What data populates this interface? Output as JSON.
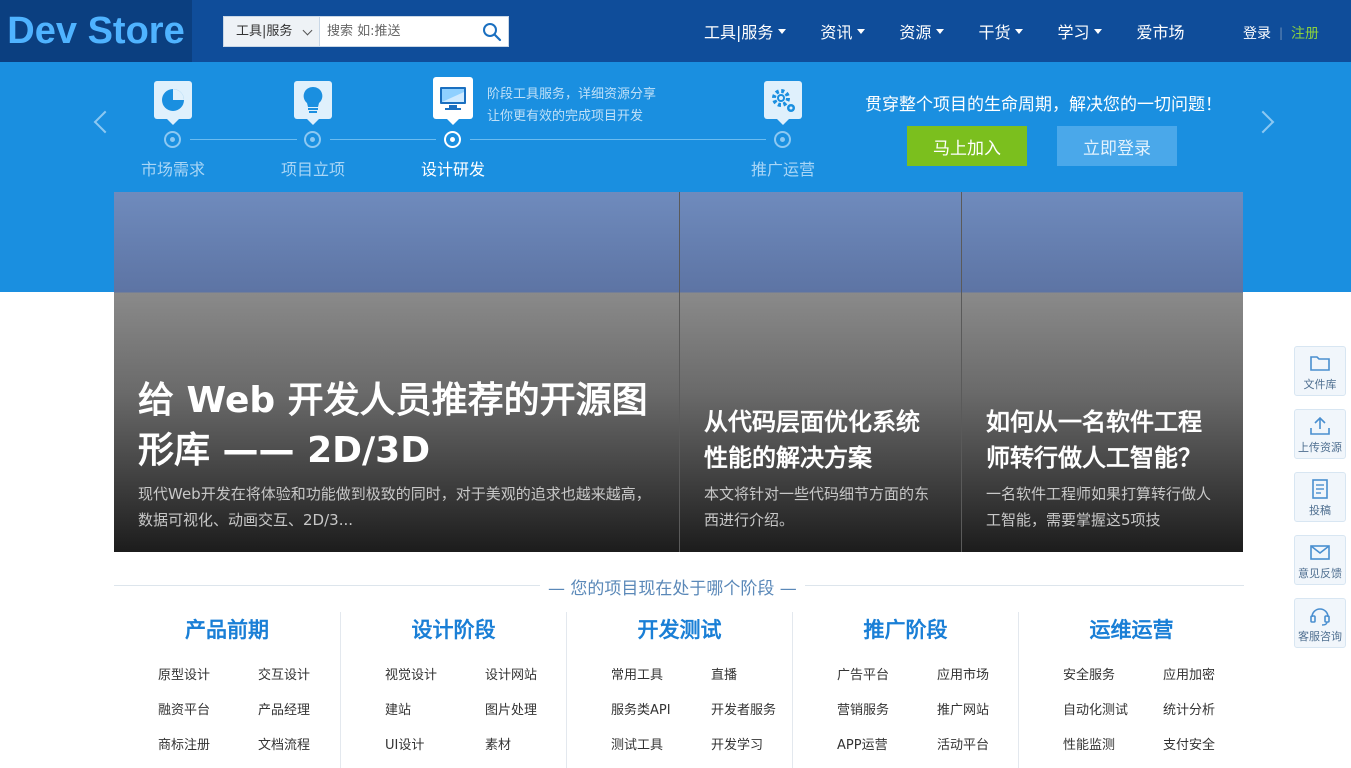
{
  "header": {
    "logo": "Dev Store",
    "search": {
      "type_label": "工具|服务",
      "placeholder": "搜索 如:推送"
    },
    "nav": [
      {
        "label": "工具|服务",
        "has_menu": true
      },
      {
        "label": "资讯",
        "has_menu": true
      },
      {
        "label": "资源",
        "has_menu": true
      },
      {
        "label": "干货",
        "has_menu": true
      },
      {
        "label": "学习",
        "has_menu": true
      },
      {
        "label": "爱市场",
        "has_menu": false
      }
    ],
    "login": "登录",
    "separator": "|",
    "register": "注册"
  },
  "banner": {
    "stages": [
      {
        "label": "市场需求",
        "icon": "pie-chart-icon"
      },
      {
        "label": "项目立项",
        "icon": "lightbulb-icon"
      },
      {
        "label": "设计研发",
        "icon": "monitor-icon",
        "active": true
      },
      {
        "label": "推广运营",
        "icon": "gear-icon"
      }
    ],
    "tip_line1": "阶段工具服务，详细资源分享",
    "tip_line2": "让你更有效的完成项目开发",
    "promo": "贯穿整个项目的生命周期，解决您的一切问题！",
    "join_button": "马上加入",
    "login_button": "立即登录"
  },
  "articles": [
    {
      "title": "给 Web 开发人员推荐的开源图形库 —— 2D/3D",
      "summary": "现代Web开发在将体验和功能做到极致的同时，对于美观的追求也越来越高，数据可视化、动画交互、2D/3..."
    },
    {
      "title": "从代码层面优化系统性能的解决方案",
      "summary": "本文将针对一些代码细节方面的东西进行介绍。"
    },
    {
      "title": "如何从一名软件工程师转行做人工智能？",
      "summary": "一名软件工程师如果打算转行做人工智能，需要掌握这5项技"
    }
  ],
  "section_title": "—  您的项目现在处于哪个阶段  —",
  "phases": [
    {
      "title": "产品前期",
      "links": [
        "原型设计",
        "交互设计",
        "融资平台",
        "产品经理",
        "商标注册",
        "文档流程"
      ]
    },
    {
      "title": "设计阶段",
      "links": [
        "视觉设计",
        "设计网站",
        "建站",
        "图片处理",
        "UI设计",
        "素材"
      ]
    },
    {
      "title": "开发测试",
      "links": [
        "常用工具",
        "直播",
        "服务类API",
        "开发者服务",
        "测试工具",
        "开发学习"
      ]
    },
    {
      "title": "推广阶段",
      "links": [
        "广告平台",
        "应用市场",
        "营销服务",
        "推广网站",
        "APP运营",
        "活动平台"
      ]
    },
    {
      "title": "运维运营",
      "links": [
        "安全服务",
        "应用加密",
        "自动化测试",
        "统计分析",
        "性能监测",
        "支付安全"
      ]
    }
  ],
  "sidebar": [
    {
      "label": "文件库",
      "icon": "folder-icon"
    },
    {
      "label": "上传资源",
      "icon": "upload-icon"
    },
    {
      "label": "投稿",
      "icon": "document-icon"
    },
    {
      "label": "意见反馈",
      "icon": "mail-icon"
    },
    {
      "label": "客服咨询",
      "icon": "headset-icon"
    }
  ],
  "colors": {
    "header_bg": "#0f4d9a",
    "band_bg": "#1a8fe0",
    "join_green": "#7bbf1e",
    "phase_title_blue": "#1a7fd6",
    "register_green": "#8bd23e"
  }
}
